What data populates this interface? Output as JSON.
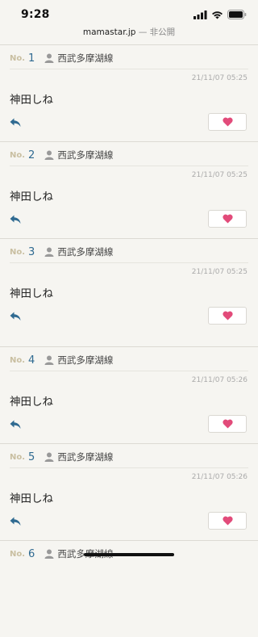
{
  "status_bar": {
    "time": "9:28"
  },
  "browser": {
    "domain": "mamastar.jp",
    "separator": "—",
    "label": "非公開"
  },
  "posts": [
    {
      "no_label": "No.",
      "number": "1",
      "author": "西武多摩湖線",
      "date": "21/11/07 05:25",
      "body": "神田しね"
    },
    {
      "no_label": "No.",
      "number": "2",
      "author": "西武多摩湖線",
      "date": "21/11/07 05:25",
      "body": "神田しね"
    },
    {
      "no_label": "No.",
      "number": "3",
      "author": "西武多摩湖線",
      "date": "21/11/07 05:25",
      "body": "神田しね"
    },
    {
      "no_label": "No.",
      "number": "4",
      "author": "西武多摩湖線",
      "date": "21/11/07 05:26",
      "body": "神田しね"
    },
    {
      "no_label": "No.",
      "number": "5",
      "author": "西武多摩湖線",
      "date": "21/11/07 05:26",
      "body": "神田しね"
    },
    {
      "no_label": "No.",
      "number": "6",
      "author": "西武多摩湖線"
    }
  ],
  "colors": {
    "number": "#2f6a91",
    "heart": "#e24b7a",
    "reply": "#2f6a91",
    "no_label": "#c9bfa1"
  },
  "icons": {
    "reply": "reply-arrow-icon",
    "like": "heart-icon",
    "author": "person-icon"
  }
}
